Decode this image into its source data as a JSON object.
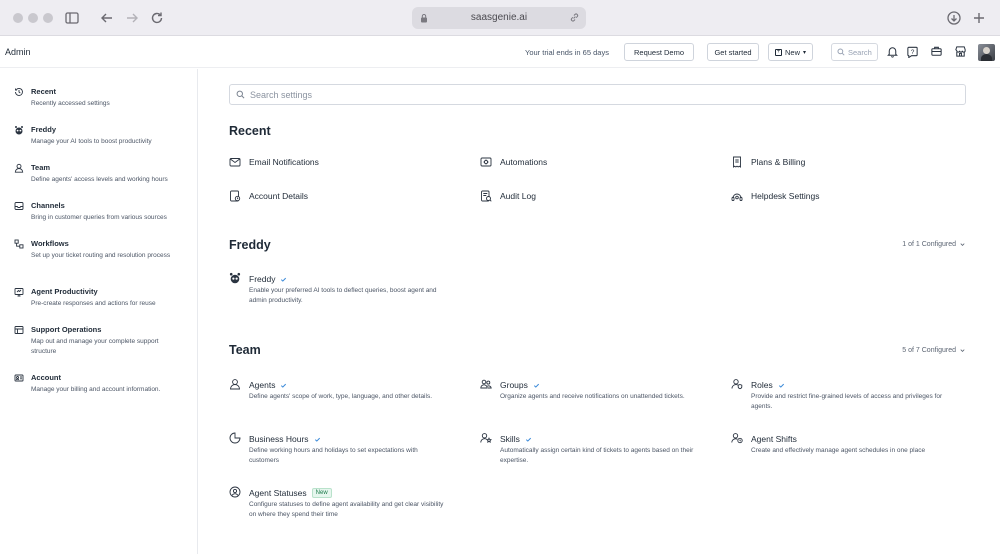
{
  "browser": {
    "url": "saasgenie.ai"
  },
  "header": {
    "title": "Admin",
    "trial_text": "Your trial ends in 65 days",
    "request_demo": "Request Demo",
    "get_started": "Get started",
    "new_label": "New",
    "search_placeholder": "Search",
    "help_count": "?"
  },
  "sidebar": {
    "items": [
      {
        "title": "Recent",
        "desc": "Recently accessed settings",
        "icon": "history-icon"
      },
      {
        "title": "Freddy",
        "desc": "Manage your AI tools to boost productivity",
        "icon": "freddy-icon"
      },
      {
        "title": "Team",
        "desc": "Define agents' access levels and working hours",
        "icon": "person-icon"
      },
      {
        "title": "Channels",
        "desc": "Bring in customer queries from various sources",
        "icon": "inbox-icon"
      },
      {
        "title": "Workflows",
        "desc": "Set up your ticket routing and resolution process",
        "icon": "workflow-icon"
      },
      {
        "title": "Agent Productivity",
        "desc": "Pre-create responses and actions for reuse",
        "icon": "productivity-icon"
      },
      {
        "title": "Support Operations",
        "desc": "Map out and manage your complete support structure",
        "icon": "operations-icon"
      },
      {
        "title": "Account",
        "desc": "Manage your billing and account information.",
        "icon": "account-icon"
      }
    ]
  },
  "main": {
    "search_placeholder": "Search settings",
    "recent": {
      "title": "Recent",
      "links": [
        {
          "label": "Email Notifications",
          "icon": "email-icon"
        },
        {
          "label": "Automations",
          "icon": "automation-icon"
        },
        {
          "label": "Plans & Billing",
          "icon": "billing-icon"
        },
        {
          "label": "Account Details",
          "icon": "account-details-icon"
        },
        {
          "label": "Audit Log",
          "icon": "audit-log-icon"
        },
        {
          "label": "Helpdesk Settings",
          "icon": "settings-icon"
        }
      ]
    },
    "freddy": {
      "title": "Freddy",
      "configured": "1 of 1 Configured",
      "cards": [
        {
          "title": "Freddy",
          "desc": "Enable your preferred AI tools to deflect queries, boost agent and admin productivity."
        }
      ]
    },
    "team": {
      "title": "Team",
      "configured": "5 of 7 Configured",
      "cards": [
        {
          "title": "Agents",
          "desc": "Define agents' scope of work, type, language, and other details."
        },
        {
          "title": "Groups",
          "desc": "Organize agents and receive notifications on unattended tickets."
        },
        {
          "title": "Roles",
          "desc": "Provide and restrict fine-grained levels of access and privileges for agents."
        },
        {
          "title": "Business Hours",
          "desc": "Define working hours and holidays to set expectations with customers"
        },
        {
          "title": "Skills",
          "desc": "Automatically assign certain kind of tickets to agents based on their expertise."
        },
        {
          "title": "Agent Shifts",
          "desc": "Create and effectively manage agent schedules in one place"
        },
        {
          "title": "Agent Statuses",
          "badge": "New",
          "desc": "Configure statuses to define agent availability and get clear visibility on where they spend their time"
        }
      ]
    }
  }
}
